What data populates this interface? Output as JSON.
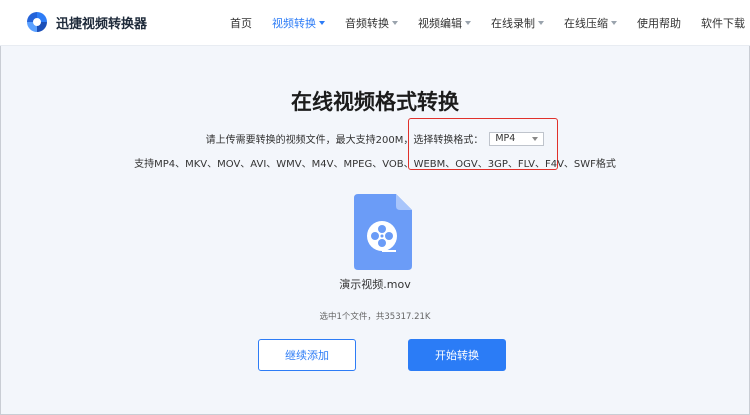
{
  "brand": {
    "name": "迅捷视频转换器"
  },
  "nav": {
    "items": [
      {
        "label": "首页",
        "active": false,
        "dropdown": false
      },
      {
        "label": "视频转换",
        "active": true,
        "dropdown": true
      },
      {
        "label": "音频转换",
        "active": false,
        "dropdown": true
      },
      {
        "label": "视频编辑",
        "active": false,
        "dropdown": true
      },
      {
        "label": "在线录制",
        "active": false,
        "dropdown": true
      },
      {
        "label": "在线压缩",
        "active": false,
        "dropdown": true
      },
      {
        "label": "使用帮助",
        "active": false,
        "dropdown": false
      },
      {
        "label": "软件下载",
        "active": false,
        "dropdown": false
      }
    ]
  },
  "main": {
    "title": "在线视频格式转换",
    "instruction": "请上传需要转换的视频文件，最大支持200M，选择转换格式：",
    "format_selected": "MP4",
    "supported_formats": "支持MP4、MKV、MOV、AVI、WMV、M4V、MPEG、VOB、WEBM、OGV、3GP、FLV、F4V、SWF格式"
  },
  "file": {
    "name": "演示视频.mov",
    "info": "选中1个文件，共35317.21K"
  },
  "buttons": {
    "add_more": "继续添加",
    "start": "开始转换"
  },
  "colors": {
    "accent": "#2d7cf6",
    "highlight_box": "#e0312b",
    "page_bg": "#f3f6fb",
    "file_icon": "#6b9cf7"
  }
}
